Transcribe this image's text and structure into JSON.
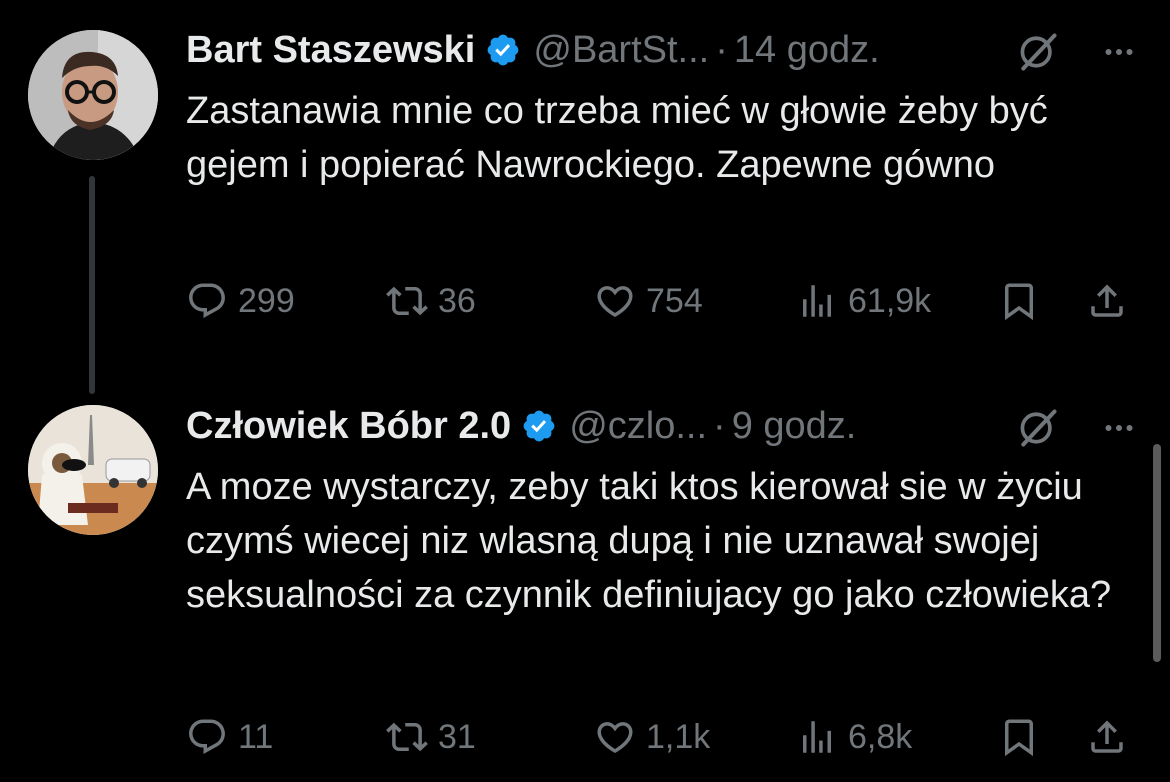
{
  "colors": {
    "background": "#000000",
    "text": "#e7e9ea",
    "muted": "#71767b",
    "verified": "#1d9bf0"
  },
  "tweets": [
    {
      "name": "Bart Staszewski",
      "handle": "@BartSt...",
      "separator": "·",
      "time": "14 godz.",
      "text": "Zastanawia mnie co trzeba mieć w głowie żeby być gejem i popierać Nawrockiego. Zapewne gówno",
      "stats": {
        "replies": "299",
        "retweets": "36",
        "likes": "754",
        "views": "61,9k"
      },
      "icons": [
        "verified-badge-icon",
        "grok-icon",
        "more-icon",
        "reply-icon",
        "retweet-icon",
        "like-icon",
        "views-icon",
        "bookmark-icon",
        "share-icon"
      ]
    },
    {
      "name": "Człowiek Bóbr 2.0",
      "handle": "@czlo...",
      "separator": "·",
      "time": "9 godz.",
      "text": "A moze wystarczy, zeby taki ktos kierował sie w życiu czymś wiecej niz wlasną dupą i nie uznawał swojej seksualności za czynnik definiujacy go jako człowieka?",
      "stats": {
        "replies": "11",
        "retweets": "31",
        "likes": "1,1k",
        "views": "6,8k"
      },
      "icons": [
        "verified-badge-icon",
        "grok-icon",
        "more-icon",
        "reply-icon",
        "retweet-icon",
        "like-icon",
        "views-icon",
        "bookmark-icon",
        "share-icon"
      ]
    }
  ]
}
